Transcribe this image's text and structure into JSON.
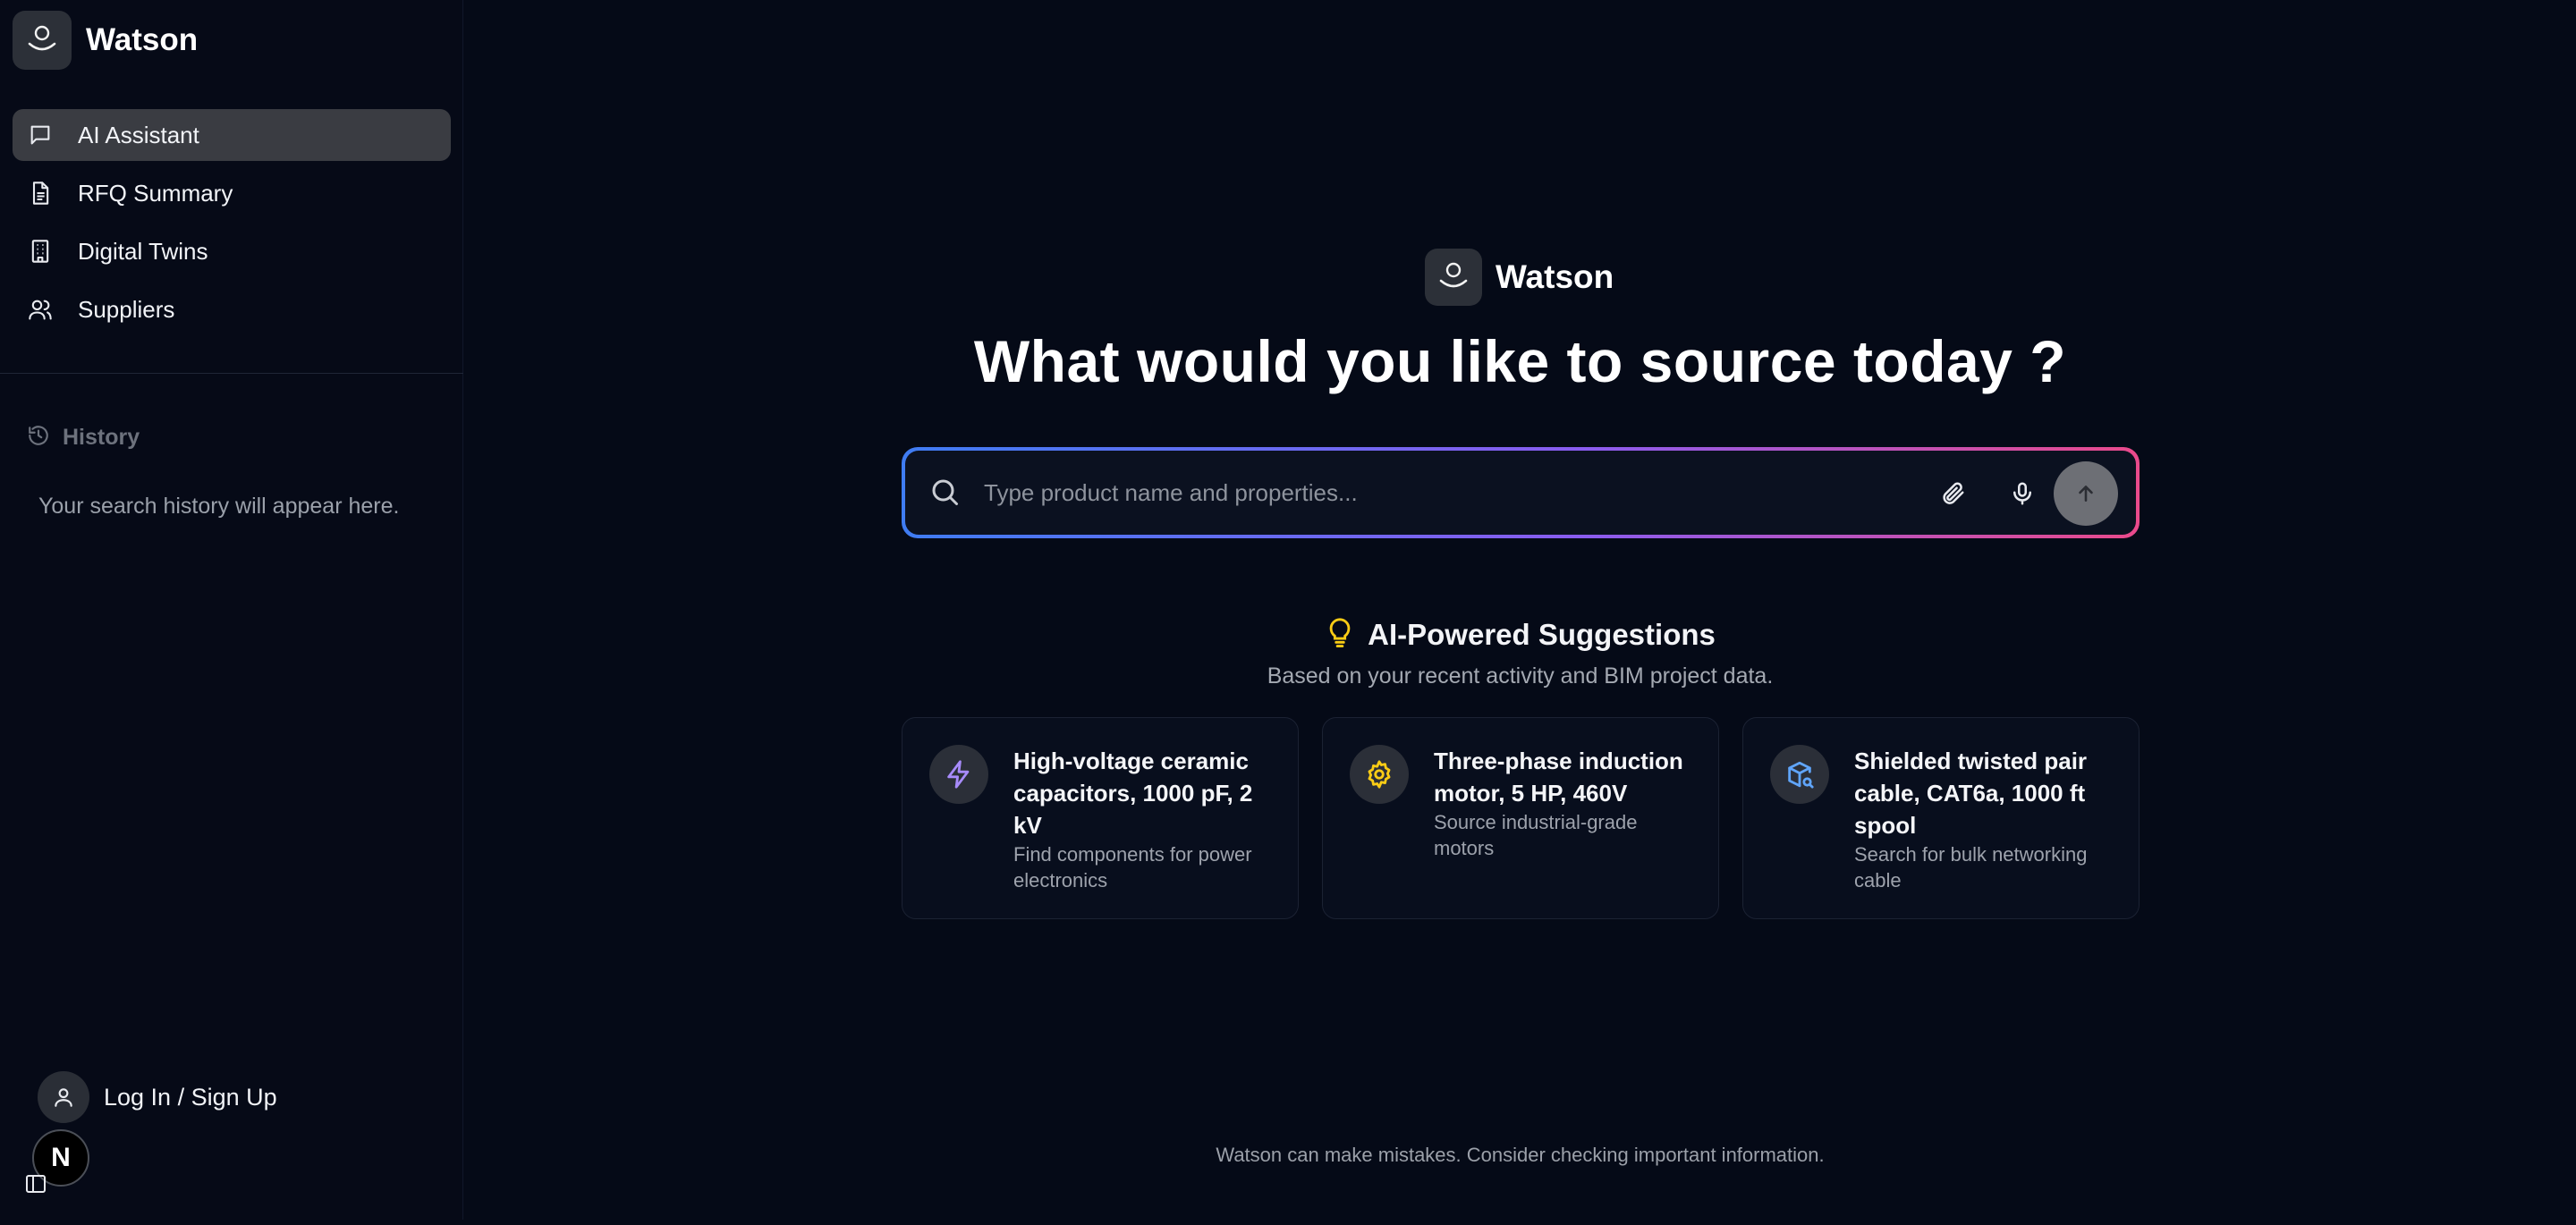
{
  "brand": {
    "name": "Watson"
  },
  "sidebar": {
    "items": [
      {
        "label": "AI Assistant",
        "icon": "message-square-icon",
        "active": true
      },
      {
        "label": "RFQ Summary",
        "icon": "document-icon",
        "active": false
      },
      {
        "label": "Digital Twins",
        "icon": "building-icon",
        "active": false
      },
      {
        "label": "Suppliers",
        "icon": "users-icon",
        "active": false
      }
    ],
    "history": {
      "label": "History",
      "empty_text": "Your search history will appear here."
    },
    "login_label": "Log In / Sign Up",
    "badge_letter": "N"
  },
  "main": {
    "brand_name": "Watson",
    "headline": "What would you like to source today ?",
    "search": {
      "placeholder": "Type product name and properties...",
      "value": ""
    },
    "suggestions": {
      "title": "AI-Powered Suggestions",
      "subtitle": "Based on your recent activity and BIM project data.",
      "cards": [
        {
          "title": "High-voltage ceramic capacitors, 1000 pF, 2 kV",
          "description": "Find components for power electronics",
          "icon": "lightning-icon",
          "color": "#a78bfa"
        },
        {
          "title": "Three-phase induction motor, 5 HP, 460V",
          "description": "Source industrial-grade motors",
          "icon": "gear-icon",
          "color": "#facc15"
        },
        {
          "title": "Shielded twisted pair cable, CAT6a, 1000 ft spool",
          "description": "Search for bulk networking cable",
          "icon": "package-search-icon",
          "color": "#60a5fa"
        }
      ]
    },
    "footer": "Watson can make mistakes. Consider checking important information."
  },
  "colors": {
    "background": "#050a17",
    "active_nav": "#3a3c42",
    "gradient_start": "#3f7cf2",
    "gradient_end": "#ea4a8b",
    "bulb": "#facc15"
  }
}
